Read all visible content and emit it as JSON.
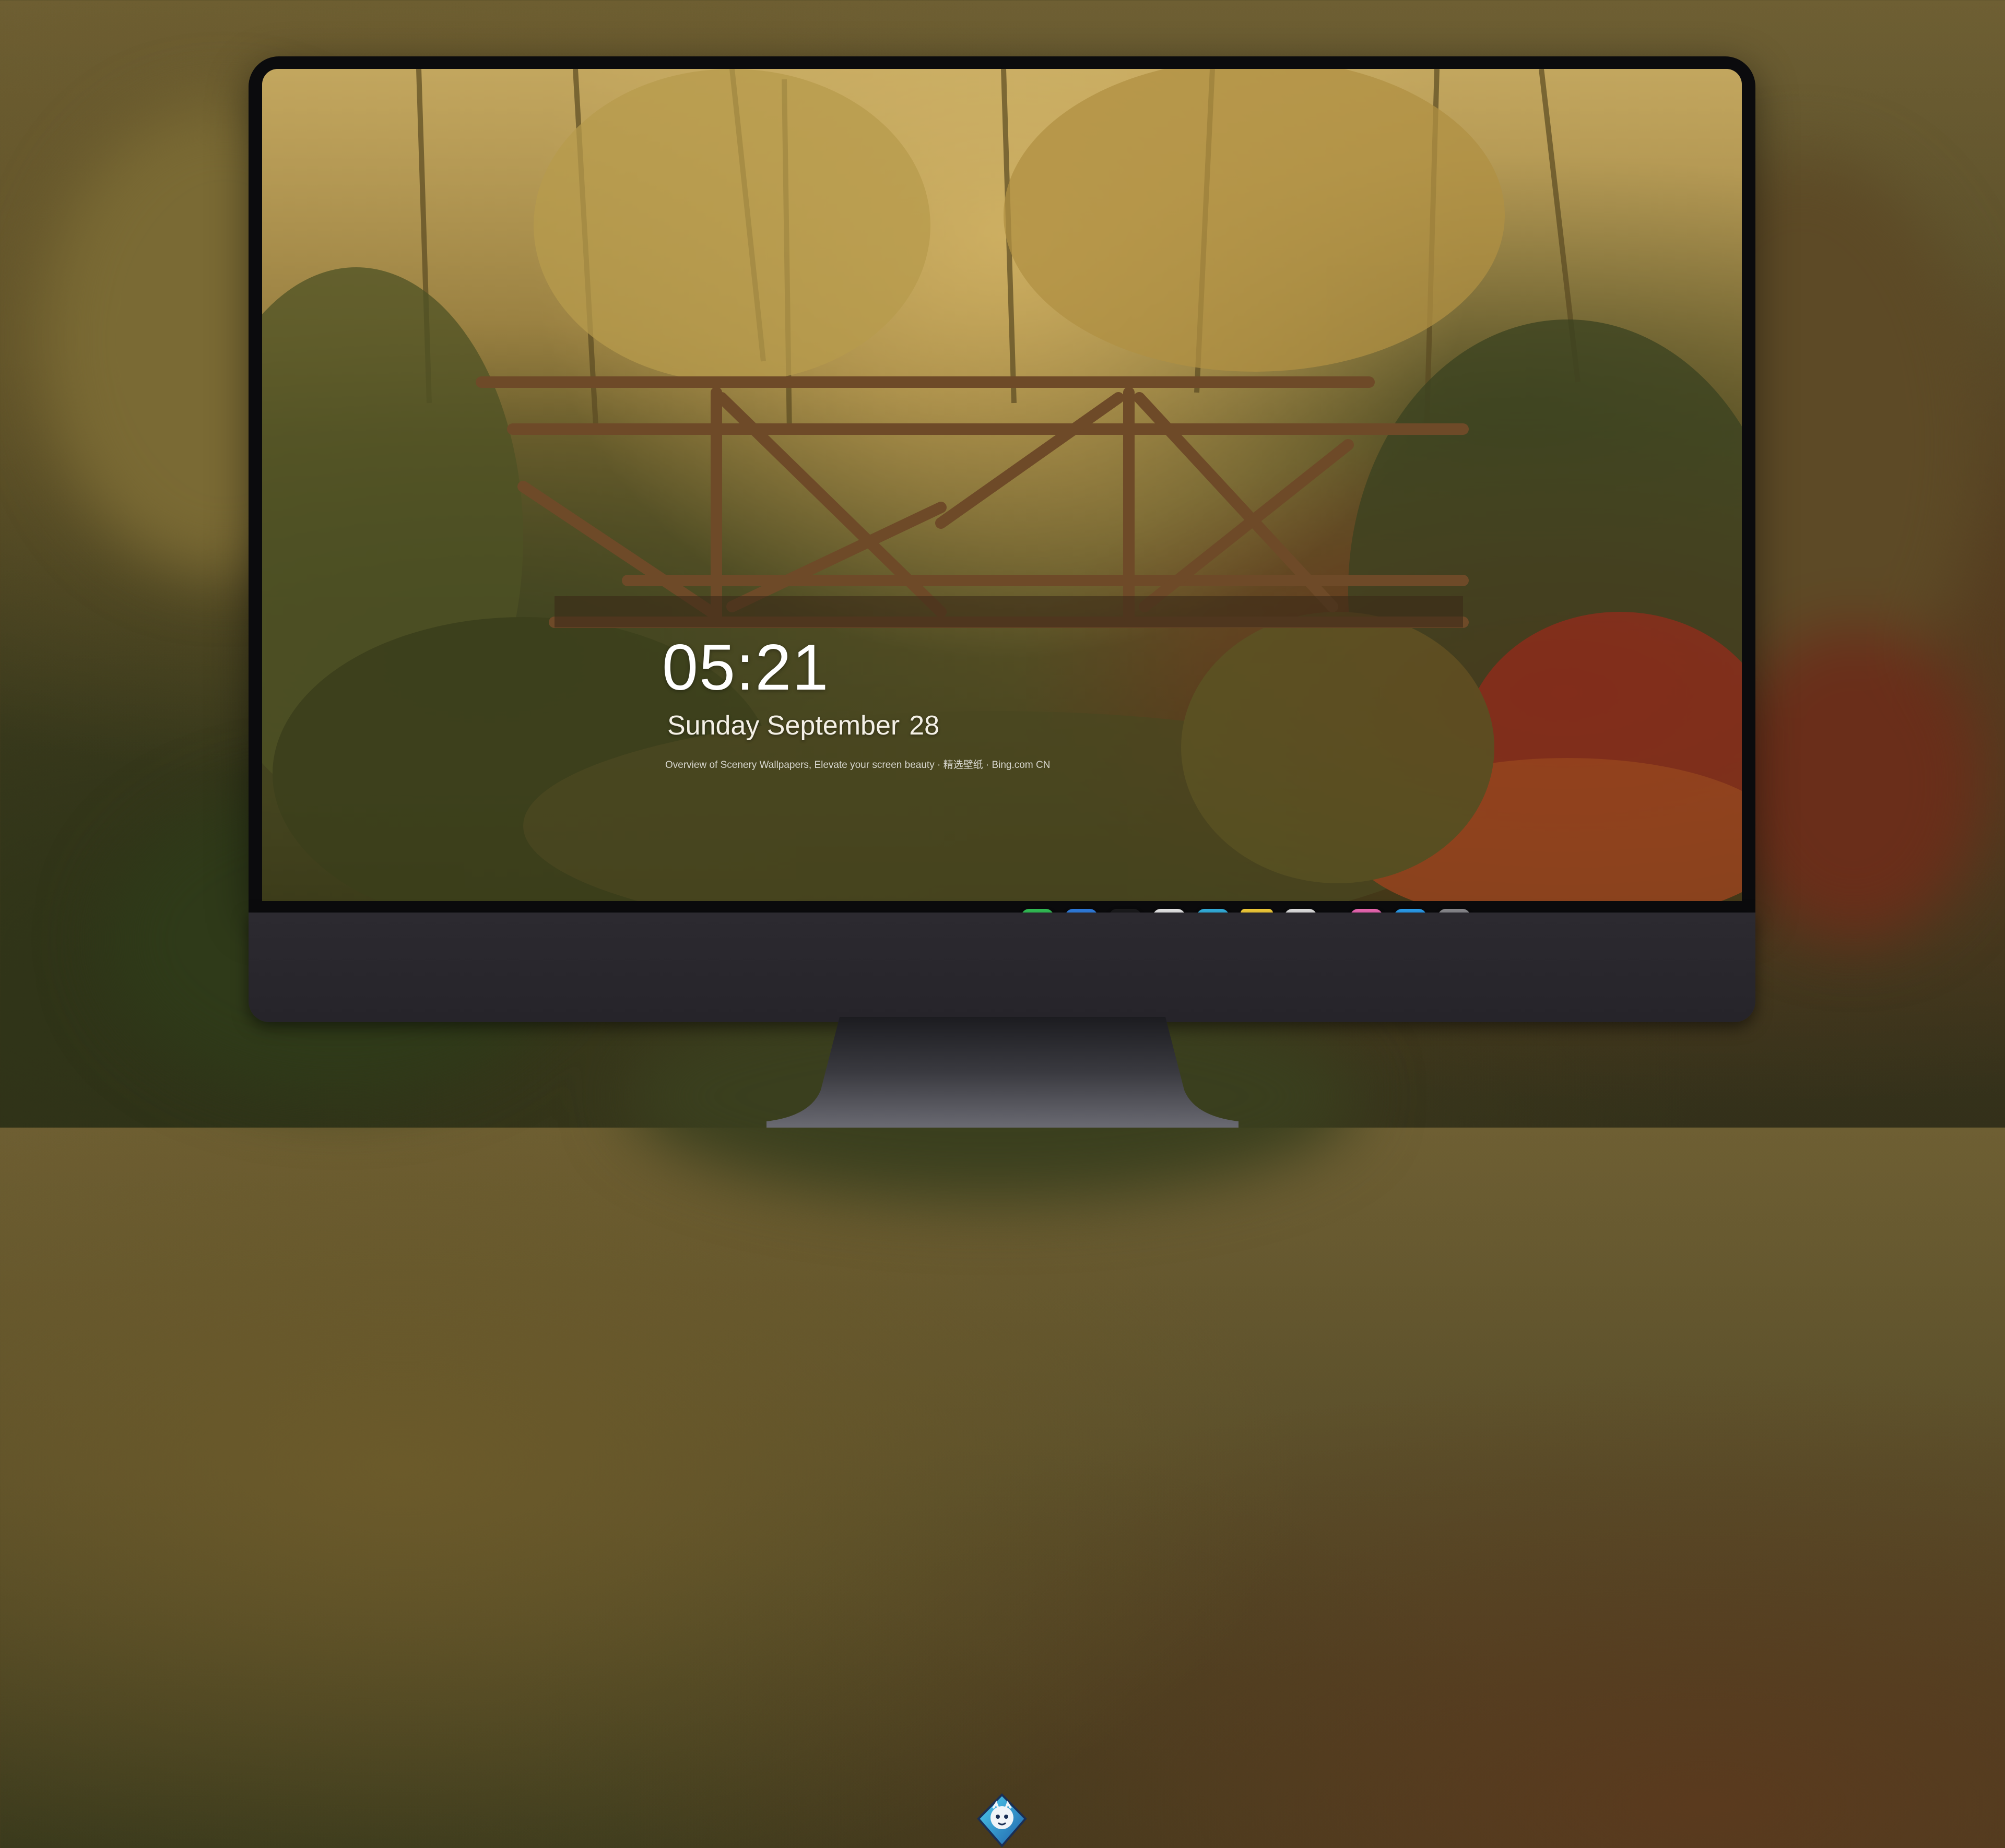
{
  "lock_screen": {
    "time": "05:21",
    "weekday_month": "Sunday September",
    "day": "28",
    "caption": "Overview of  Scenery Wallpapers, Elevate your screen beauty · 精选壁纸 · Bing.com CN"
  },
  "dock": {
    "apps": [
      {
        "name": "messages-icon",
        "color": "#34c759"
      },
      {
        "name": "weather-icon",
        "color": "#2f8ff0"
      },
      {
        "name": "clock-icon",
        "color": "#1c1c1e"
      },
      {
        "name": "preview-icon",
        "color": "#e8e8e8"
      },
      {
        "name": "clips-icon",
        "color": "#35b6e6"
      },
      {
        "name": "notes-icon",
        "color": "#fcd43b"
      },
      {
        "name": "photo-booth-icon",
        "color": "#e8e8e8"
      },
      {
        "name": "music-icon",
        "color": "#f04ea5"
      },
      {
        "name": "app-store-icon",
        "color": "#1a8cf0"
      },
      {
        "name": "camera-icon",
        "color": "#8e8e93"
      }
    ]
  },
  "colors": {
    "bezel": "#0b0b0d",
    "chin": "#2c2a30",
    "stand": "#2a2a2e"
  }
}
